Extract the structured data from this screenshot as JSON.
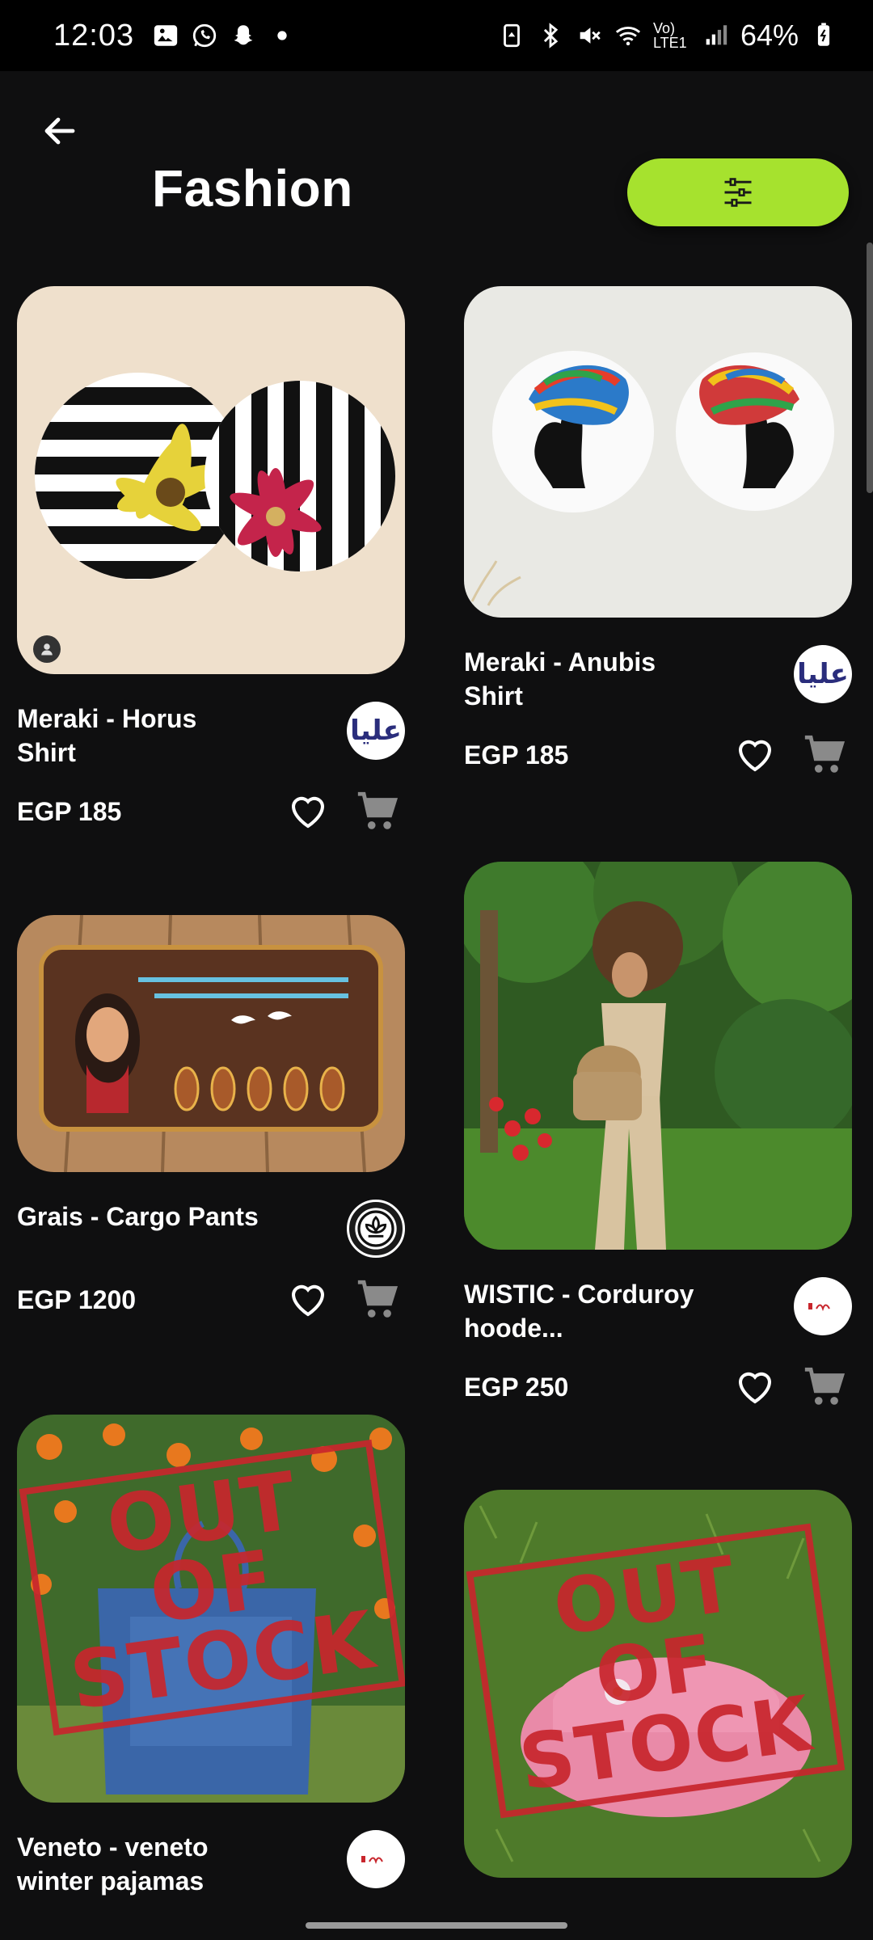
{
  "status_bar": {
    "time": "12:03",
    "battery": "64%",
    "network_label": "Vo) LTE1",
    "left_icons": [
      "gallery-icon",
      "whatsapp-icon",
      "snapchat-icon",
      "dot-icon"
    ],
    "right_icons": [
      "battery-saver-icon",
      "bluetooth-icon",
      "mute-icon",
      "wifi-icon",
      "signal-icon",
      "battery-icon"
    ]
  },
  "header": {
    "title": "Fashion",
    "back_icon": "arrow-left-icon",
    "filter_icon": "sliders-icon",
    "accent_color": "#a6e22e"
  },
  "products": [
    {
      "name": "Meraki - Horus Shirt",
      "price": "EGP 185",
      "seller_logo_text": "عليا",
      "out_of_stock": false
    },
    {
      "name": "Meraki - Anubis Shirt",
      "price": "EGP 185",
      "seller_logo_text": "عليا",
      "out_of_stock": false
    },
    {
      "name": "Grais - Cargo Pants",
      "price": "EGP 1200",
      "seller_logo_text": "",
      "out_of_stock": false
    },
    {
      "name": "WISTIC - Corduroy hoode...",
      "price": "EGP 250",
      "seller_logo_text": "",
      "out_of_stock": false
    },
    {
      "name": "Veneto  - veneto winter pajamas",
      "price": "",
      "seller_logo_text": "",
      "out_of_stock": true,
      "stamp_text": "OUT OF STOCK"
    },
    {
      "name": "",
      "price": "",
      "seller_logo_text": "",
      "out_of_stock": true,
      "stamp_text": "OUT OF STOCK"
    }
  ],
  "stamp": {
    "line1": "OUT OF",
    "line2": "STOCK",
    "color": "#c8262d"
  }
}
